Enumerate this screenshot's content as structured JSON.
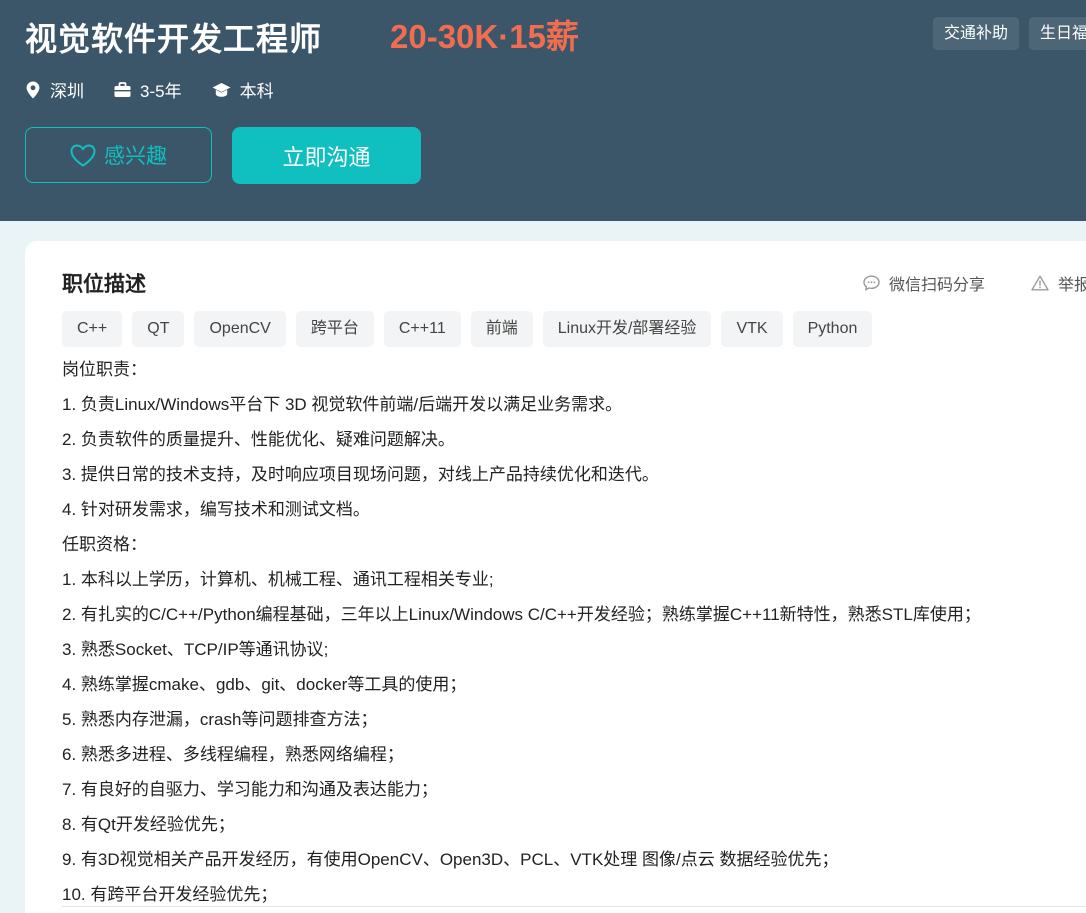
{
  "job": {
    "title": "视觉软件开发工程师",
    "salary": "20-30K·15薪",
    "benefits": [
      "交通补助",
      "生日福利"
    ],
    "city": "深圳",
    "experience": "3-5年",
    "education": "本科"
  },
  "actions": {
    "interest_label": "感兴趣",
    "chat_label": "立即沟通",
    "share_label": "微信扫码分享",
    "report_label": "举报"
  },
  "description": {
    "section_title": "职位描述",
    "skills": [
      "C++",
      "QT",
      "OpenCV",
      "跨平台",
      "C++11",
      "前端",
      "Linux开发/部署经验",
      "VTK",
      "Python"
    ],
    "lines": [
      "岗位职责：",
      "1. 负责Linux/Windows平台下 3D 视觉软件前端/后端开发以满足业务需求。",
      "2. 负责软件的质量提升、性能优化、疑难问题解决。",
      "3. 提供日常的技术支持，及时响应项目现场问题，对线上产品持续优化和迭代。",
      "4. 针对研发需求，编写技术和测试文档。",
      "任职资格：",
      "1. 本科以上学历，计算机、机械工程、通讯工程相关专业;",
      "2. 有扎实的C/C++/Python编程基础，三年以上Linux/Windows C/C++开发经验；熟练掌握C++11新特性，熟悉STL库使用；",
      "3. 熟悉Socket、TCP/IP等通讯协议;",
      "4. 熟练掌握cmake、gdb、git、docker等工具的使用；",
      "5. 熟悉内存泄漏，crash等问题排查方法；",
      "6. 熟悉多进程、多线程编程，熟悉网络编程；",
      "7. 有良好的自驱力、学习能力和沟通及表达能力；",
      "8. 有Qt开发经验优先；",
      "9. 有3D视觉相关产品开发经历，有使用OpenCV、Open3D、PCL、VTK处理 图像/点云 数据经验优先；",
      "10. 有跨平台开发经验优先；"
    ]
  },
  "colors": {
    "header_bg": "#3c5669",
    "accent": "#10c0c0",
    "salary": "#f26d50"
  }
}
